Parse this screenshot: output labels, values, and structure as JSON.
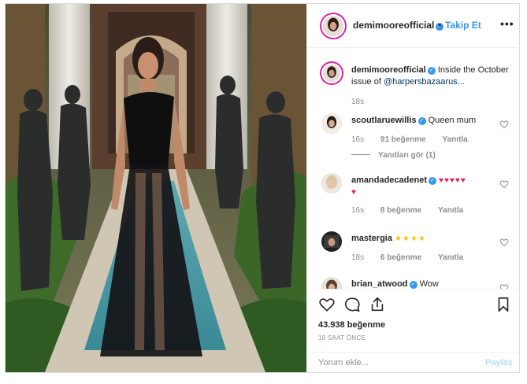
{
  "post": {
    "author": "demimooreofficial",
    "follow_label": "Takip Et",
    "more_label": "•••",
    "separator": "•"
  },
  "caption": {
    "username": "demimooreofficial",
    "text_prefix": "Inside the October issue of ",
    "mention": "@harpersbazaarus...",
    "time": "18s"
  },
  "comments": [
    {
      "username": "scoutlaruewillis",
      "text": "Queen mum",
      "time": "16s",
      "likes": "91 beğenme",
      "reply": "Yanıtla",
      "view_replies": "Yanıtları gör (1)"
    },
    {
      "username": "amandadecadenet",
      "text": "♥♥♥♥♥",
      "text2": "♥",
      "time": "16s",
      "likes": "8 beğenme",
      "reply": "Yanıtla"
    },
    {
      "username": "mastergia",
      "text": "★★★★",
      "time": "18s",
      "likes": "6 beğenme",
      "reply": "Yanıtla"
    },
    {
      "username": "brian_atwood",
      "text": "Wow"
    }
  ],
  "engagement": {
    "likes": "43.938 beğenme",
    "timestamp": "18 SAAT ÖNCE"
  },
  "composer": {
    "placeholder": "Yorum ekle...",
    "post_label": "Paylaş"
  },
  "icons": [
    "heart-icon",
    "comment-icon",
    "share-icon",
    "bookmark-icon",
    "verified-icon"
  ],
  "colors": {
    "accent": "#3897f0",
    "text": "#262626",
    "muted": "#8e8e8e",
    "disabled_post": "#b2dffc",
    "ring": "#d6249f"
  }
}
